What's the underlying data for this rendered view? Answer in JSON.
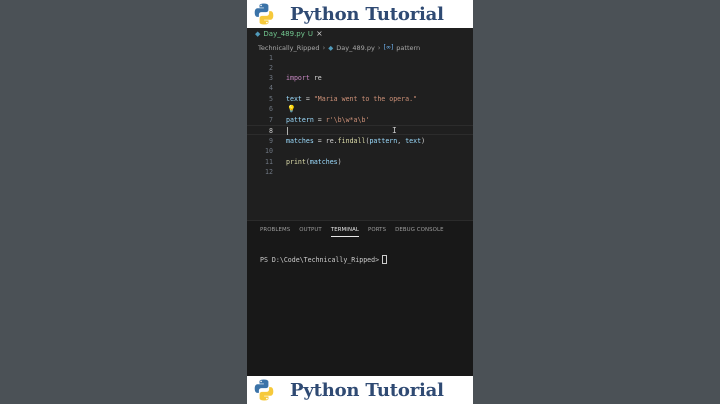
{
  "banner": {
    "title": "Python Tutorial"
  },
  "tab": {
    "filename": "Day_489.py",
    "status": "U"
  },
  "breadcrumb": {
    "folder": "Technically_Ripped",
    "file": "Day_489.py",
    "symbol": "pattern"
  },
  "editor": {
    "line_numbers": [
      "1",
      "2",
      "3",
      "4",
      "5",
      "6",
      "7",
      "8",
      "9",
      "10",
      "11",
      "12"
    ],
    "line3": {
      "kw": "import",
      "mod": "re"
    },
    "line5": {
      "var": "text",
      "eq": " = ",
      "str": "\"Maria went to the opera.\""
    },
    "line7": {
      "var": "pattern",
      "eq": " = ",
      "str": "r'\\b\\w*a\\b'"
    },
    "line9": {
      "var": "matches",
      "eq": " = ",
      "mod": "re",
      "dot": ".",
      "fn": "findall",
      "args_open": "(",
      "arg1": "pattern",
      "comma": ", ",
      "arg2": "text",
      "args_close": ")"
    },
    "line11": {
      "fn": "print",
      "open": "(",
      "arg": "matches",
      "close": ")"
    }
  },
  "panel": {
    "tabs": [
      "PROBLEMS",
      "OUTPUT",
      "TERMINAL",
      "PORTS",
      "DEBUG CONSOLE"
    ],
    "active_tab": "TERMINAL",
    "prompt": "PS D:\\Code\\Technically_Ripped>"
  },
  "colors": {
    "keyword": "#c586c0",
    "variable": "#9cdcfe",
    "string": "#ce9178",
    "function": "#dcdcaa",
    "banner_text": "#2f4a73"
  }
}
